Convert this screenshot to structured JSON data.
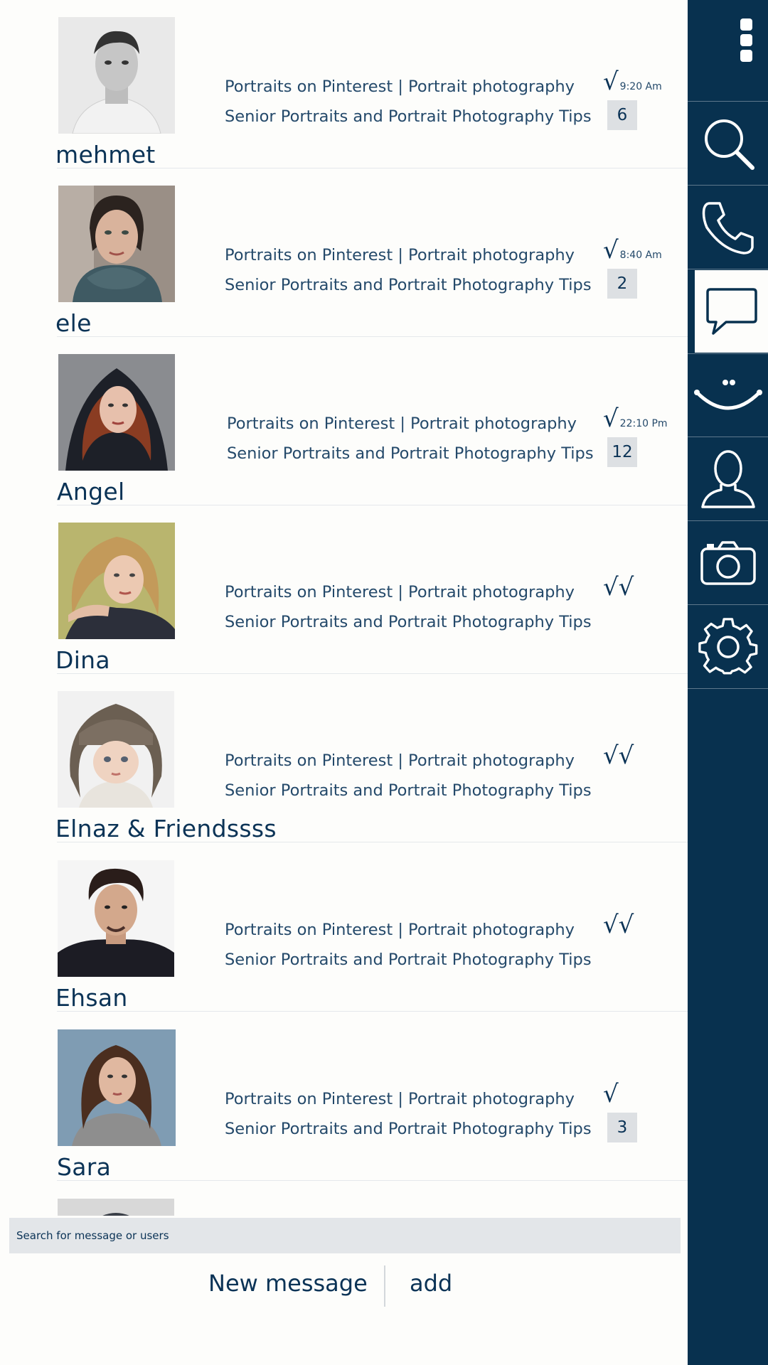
{
  "colors": {
    "sidebar": "#08314f",
    "text": "#0b3356",
    "badge_bg": "#dde0e3",
    "background": "#fdfdfb"
  },
  "sidebar": {
    "items": [
      {
        "icon": "more-vertical-icon"
      },
      {
        "icon": "search-icon"
      },
      {
        "icon": "phone-icon"
      },
      {
        "icon": "chat-bubble-icon",
        "active": true
      },
      {
        "icon": "smiley-icon"
      },
      {
        "icon": "user-icon"
      },
      {
        "icon": "camera-icon"
      },
      {
        "icon": "gear-icon"
      }
    ]
  },
  "conversations": [
    {
      "name": "mehmet",
      "line1": "Portraits on Pinterest | Portrait photography",
      "line2": "Senior Portraits and Portrait Photography Tips",
      "check": "√",
      "time": "9:20 Am",
      "badge": "6"
    },
    {
      "name": "ele",
      "line1": "Portraits on Pinterest | Portrait photography",
      "line2": "Senior Portraits and Portrait Photography Tips",
      "check": "√",
      "time": "8:40 Am",
      "badge": "2"
    },
    {
      "name": "Angel",
      "line1": "Portraits on Pinterest | Portrait photography",
      "line2": "Senior Portraits and Portrait Photography Tips",
      "check": "√",
      "time": "22:10 Pm",
      "badge": "12"
    },
    {
      "name": "Dina",
      "line1": "Portraits on Pinterest | Portrait photography",
      "line2": "Senior Portraits and Portrait Photography Tips",
      "check": "√√",
      "time": "",
      "badge": ""
    },
    {
      "name": "Elnaz & Friendssss",
      "line1": "Portraits on Pinterest | Portrait photography",
      "line2": "Senior Portraits and Portrait Photography Tips",
      "check": "√√",
      "time": "",
      "badge": ""
    },
    {
      "name": "Ehsan",
      "line1": "Portraits on Pinterest | Portrait photography",
      "line2": "Senior Portraits and Portrait Photography Tips",
      "check": "√√",
      "time": "",
      "badge": ""
    },
    {
      "name": "Sara",
      "line1": "Portraits on Pinterest | Portrait photography",
      "line2": "Senior Portraits and Portrait Photography Tips",
      "check": "√",
      "time": "",
      "badge": "3"
    }
  ],
  "search": {
    "placeholder": "Search for message or users",
    "value": ""
  },
  "actions": {
    "new_message": "New message",
    "add": "add"
  }
}
